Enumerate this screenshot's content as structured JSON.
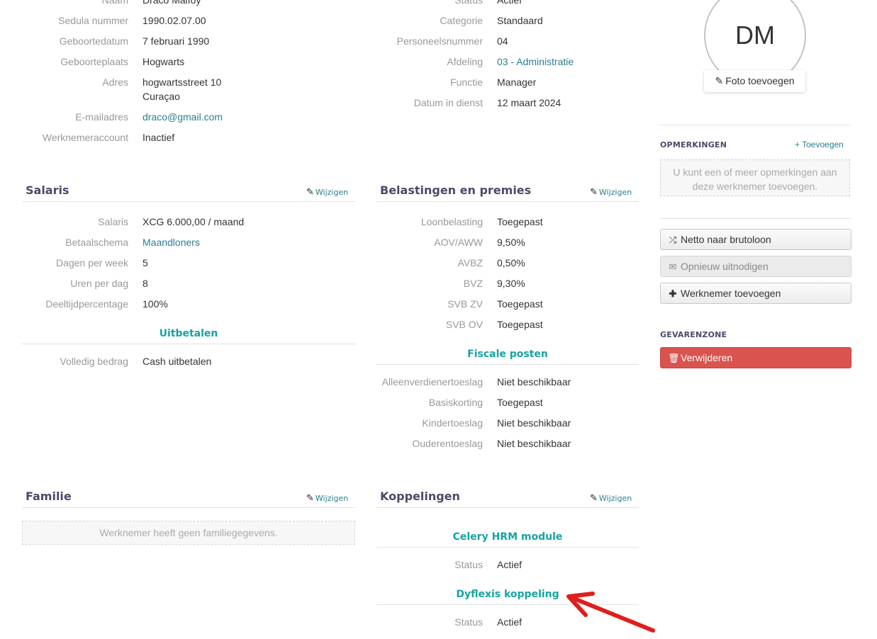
{
  "personal": {
    "rows": [
      {
        "label": "Naam",
        "value": "Draco Malfoy"
      },
      {
        "label": "Sedula nummer",
        "value": "1990.02.07.00"
      },
      {
        "label": "Geboortedatum",
        "value": "7 februari 1990"
      },
      {
        "label": "Geboorteplaats",
        "value": "Hogwarts"
      },
      {
        "label": "Adres",
        "value": "hogwartsstreet 10",
        "value2": "Curaçao"
      },
      {
        "label": "E-mailadres",
        "value": "draco@gmail.com"
      },
      {
        "label": "Werknemeraccount",
        "value": "Inactief"
      }
    ]
  },
  "employment": {
    "rows": [
      {
        "label": "Status",
        "value": "Actief"
      },
      {
        "label": "Categorie",
        "value": "Standaard"
      },
      {
        "label": "Personeelsnummer",
        "value": "04"
      },
      {
        "label": "Afdeling",
        "value": "03 - Administratie"
      },
      {
        "label": "Functie",
        "value": "Manager"
      },
      {
        "label": "Datum in dienst",
        "value": "12 maart 2024"
      }
    ]
  },
  "avatar": {
    "initials": "DM",
    "add_photo_label": "Foto toevoegen"
  },
  "salaris": {
    "title": "Salaris",
    "edit_label": "Wijzigen",
    "rows": [
      {
        "label": "Salaris",
        "value": "XCG 6.000,00 / maand"
      },
      {
        "label": "Betaalschema",
        "value": "Maandloners"
      },
      {
        "label": "Dagen per week",
        "value": "5"
      },
      {
        "label": "Uren per dag",
        "value": "8"
      },
      {
        "label": "Deeltijdpercentage",
        "value": "100%"
      }
    ],
    "payout_title": "Uitbetalen",
    "payout_rows": [
      {
        "label": "Volledig bedrag",
        "value": "Cash uitbetalen"
      }
    ]
  },
  "belastingen": {
    "title": "Belastingen en premies",
    "edit_label": "Wijzigen",
    "rows": [
      {
        "label": "Loonbelasting",
        "value": "Toegepast"
      },
      {
        "label": "AOV/AWW",
        "value": "9,50%"
      },
      {
        "label": "AVBZ",
        "value": "0,50%"
      },
      {
        "label": "BVZ",
        "value": "9,30%"
      },
      {
        "label": "SVB ZV",
        "value": "Toegepast"
      },
      {
        "label": "SVB OV",
        "value": "Toegepast"
      }
    ],
    "fiscal_title": "Fiscale posten",
    "fiscal_rows": [
      {
        "label": "Alleenverdienertoeslag",
        "value": "Niet beschikbaar"
      },
      {
        "label": "Basiskorting",
        "value": "Toegepast"
      },
      {
        "label": "Kindertoeslag",
        "value": "Niet beschikbaar"
      },
      {
        "label": "Ouderentoeslag",
        "value": "Niet beschikbaar"
      }
    ]
  },
  "familie": {
    "title": "Familie",
    "edit_label": "Wijzigen",
    "empty_text": "Werknemer heeft geen familiegegevens."
  },
  "koppelingen": {
    "title": "Koppelingen",
    "edit_label": "Wijzigen",
    "groups": [
      {
        "title": "Celery HRM module",
        "label": "Status",
        "value": "Actief"
      },
      {
        "title": "Dyflexis koppeling",
        "label": "Status",
        "value": "Actief"
      }
    ]
  },
  "sidebar": {
    "remarks_heading": "OPMERKINGEN",
    "remarks_add": "+ Toevoegen",
    "remarks_empty": "U kunt een of meer opmerkingen aan deze werknemer toevoegen.",
    "buttons": [
      {
        "label": "Netto naar brutoloon",
        "icon": "shuffle-icon"
      },
      {
        "label": "Opnieuw uitnodigen",
        "icon": "envelope-icon"
      },
      {
        "label": "Werknemer toevoegen",
        "icon": "plus-icon"
      }
    ],
    "danger_heading": "GEVARENZONE",
    "delete_label": "Verwijderen"
  },
  "colors": {
    "accent": "#17a2a2",
    "link": "#2a7f8f",
    "danger": "#d9534f",
    "annotation_arrow": "#e01e1e"
  }
}
